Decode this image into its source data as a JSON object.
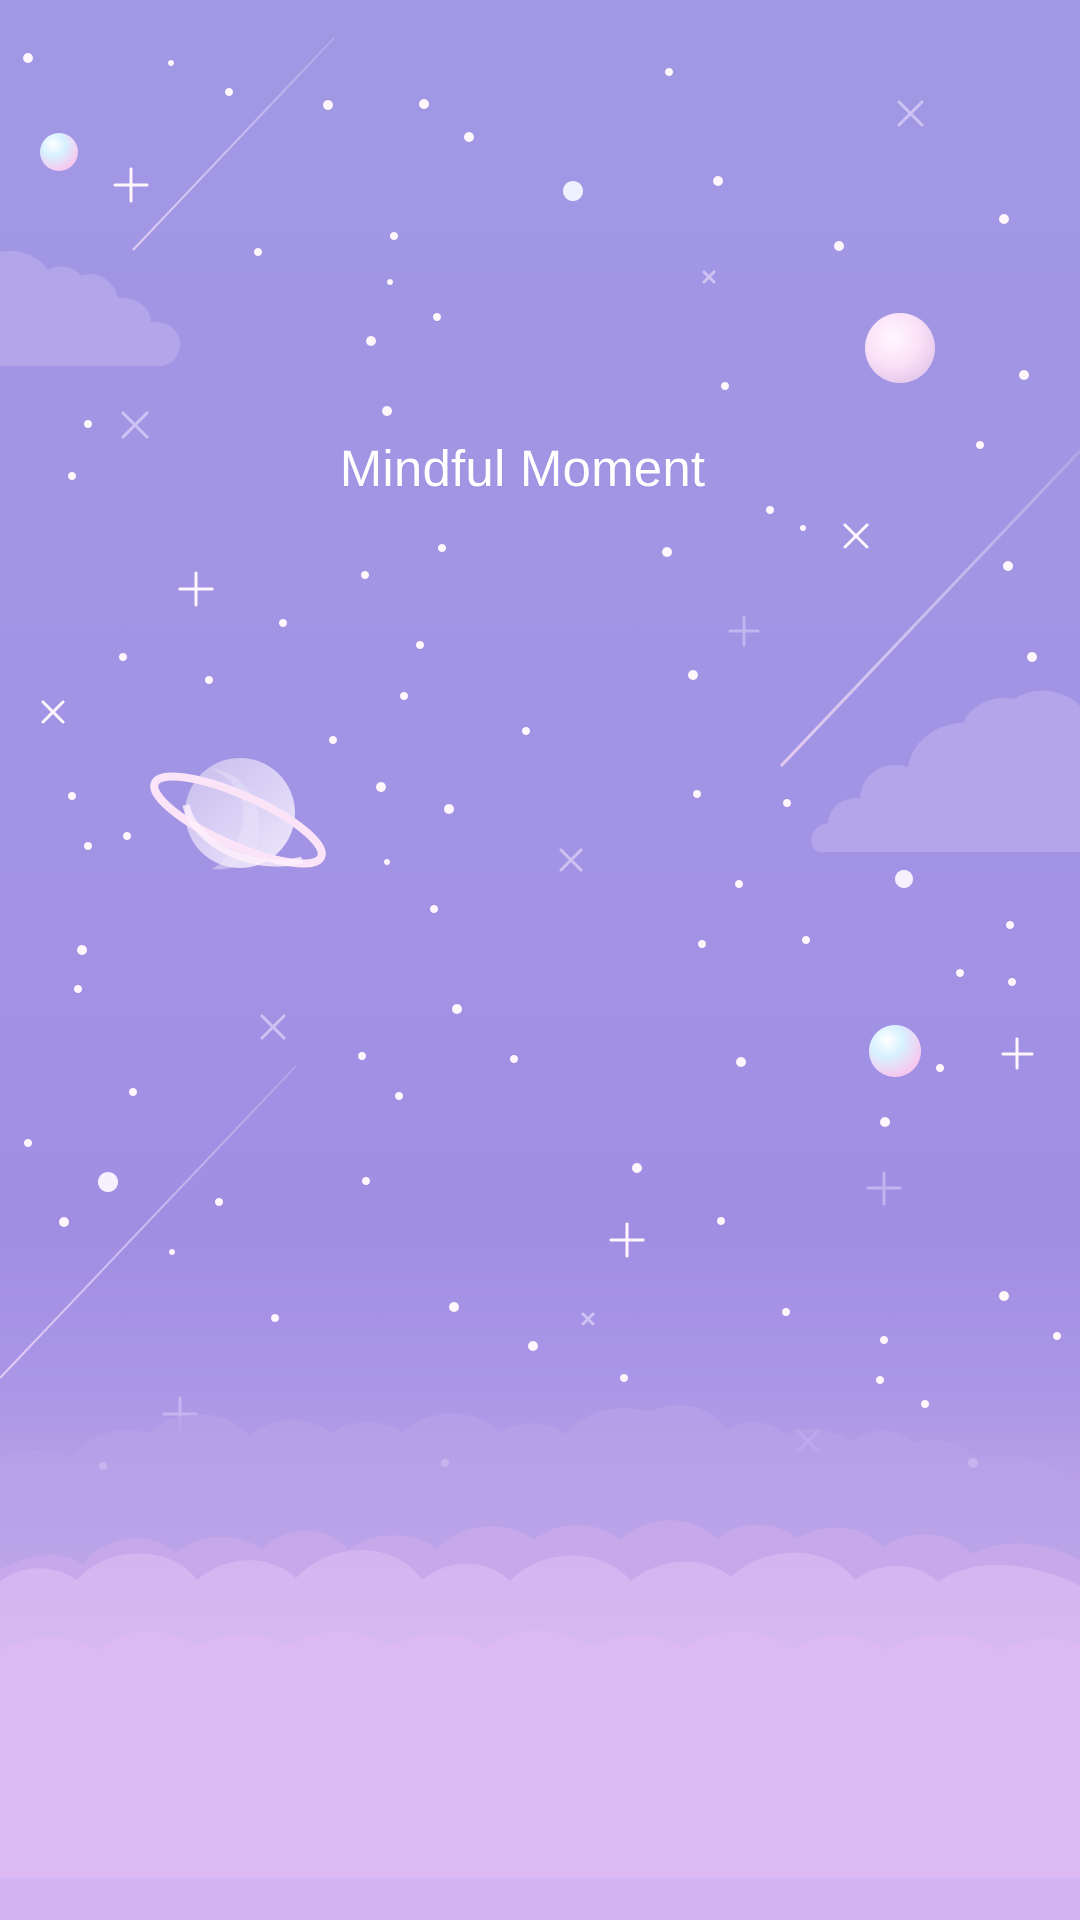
{
  "screen": {
    "title": "Mindful Moment"
  },
  "colors": {
    "sky_top": "#a198e4",
    "sky_mid": "#a293e4",
    "cloud_far": "#b8a7ea",
    "cloud_mid": "#c2a6e9",
    "cloud_near": "#dcb8f2",
    "planet": "#d9d3f4",
    "planet_ring": "#fae6f8",
    "star": "#fff6fb",
    "title": "#ffffff"
  },
  "icons": {
    "planet": "saturn-planet-icon",
    "moon": "moon-icon",
    "stars": "sparkle-icon",
    "shooting_stars": "shooting-star-icon",
    "clouds": "cloud-icon"
  }
}
